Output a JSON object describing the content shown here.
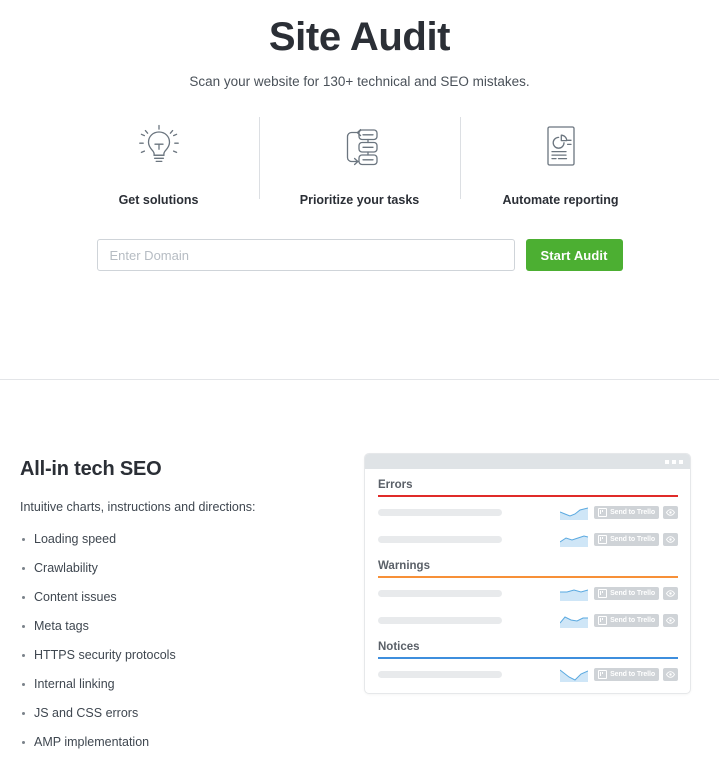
{
  "hero": {
    "title": "Site Audit",
    "subtitle": "Scan your website for 130+ technical and SEO mistakes."
  },
  "features": [
    {
      "icon": "lightbulb-icon",
      "label": "Get solutions"
    },
    {
      "icon": "task-list-icon",
      "label": "Prioritize your tasks"
    },
    {
      "icon": "report-document-icon",
      "label": "Automate reporting"
    }
  ],
  "search": {
    "placeholder": "Enter Domain",
    "value": "",
    "button_label": "Start Audit",
    "button_color": "#4caf32"
  },
  "lower": {
    "title": "All-in tech SEO",
    "intro": "Intuitive charts, instructions and directions:",
    "bullets": [
      "Loading speed",
      "Crawlability",
      "Content issues",
      "Meta tags",
      "HTTPS security protocols",
      "Internal linking",
      "JS and CSS errors",
      "AMP implementation"
    ]
  },
  "mockup": {
    "trello_button_label": "Send to Trello",
    "groups": [
      {
        "title": "Errors",
        "color": "#e02b29",
        "rows": 2
      },
      {
        "title": "Warnings",
        "color": "#f79038",
        "rows": 2
      },
      {
        "title": "Notices",
        "color": "#3e8edd",
        "rows": 1
      }
    ]
  }
}
